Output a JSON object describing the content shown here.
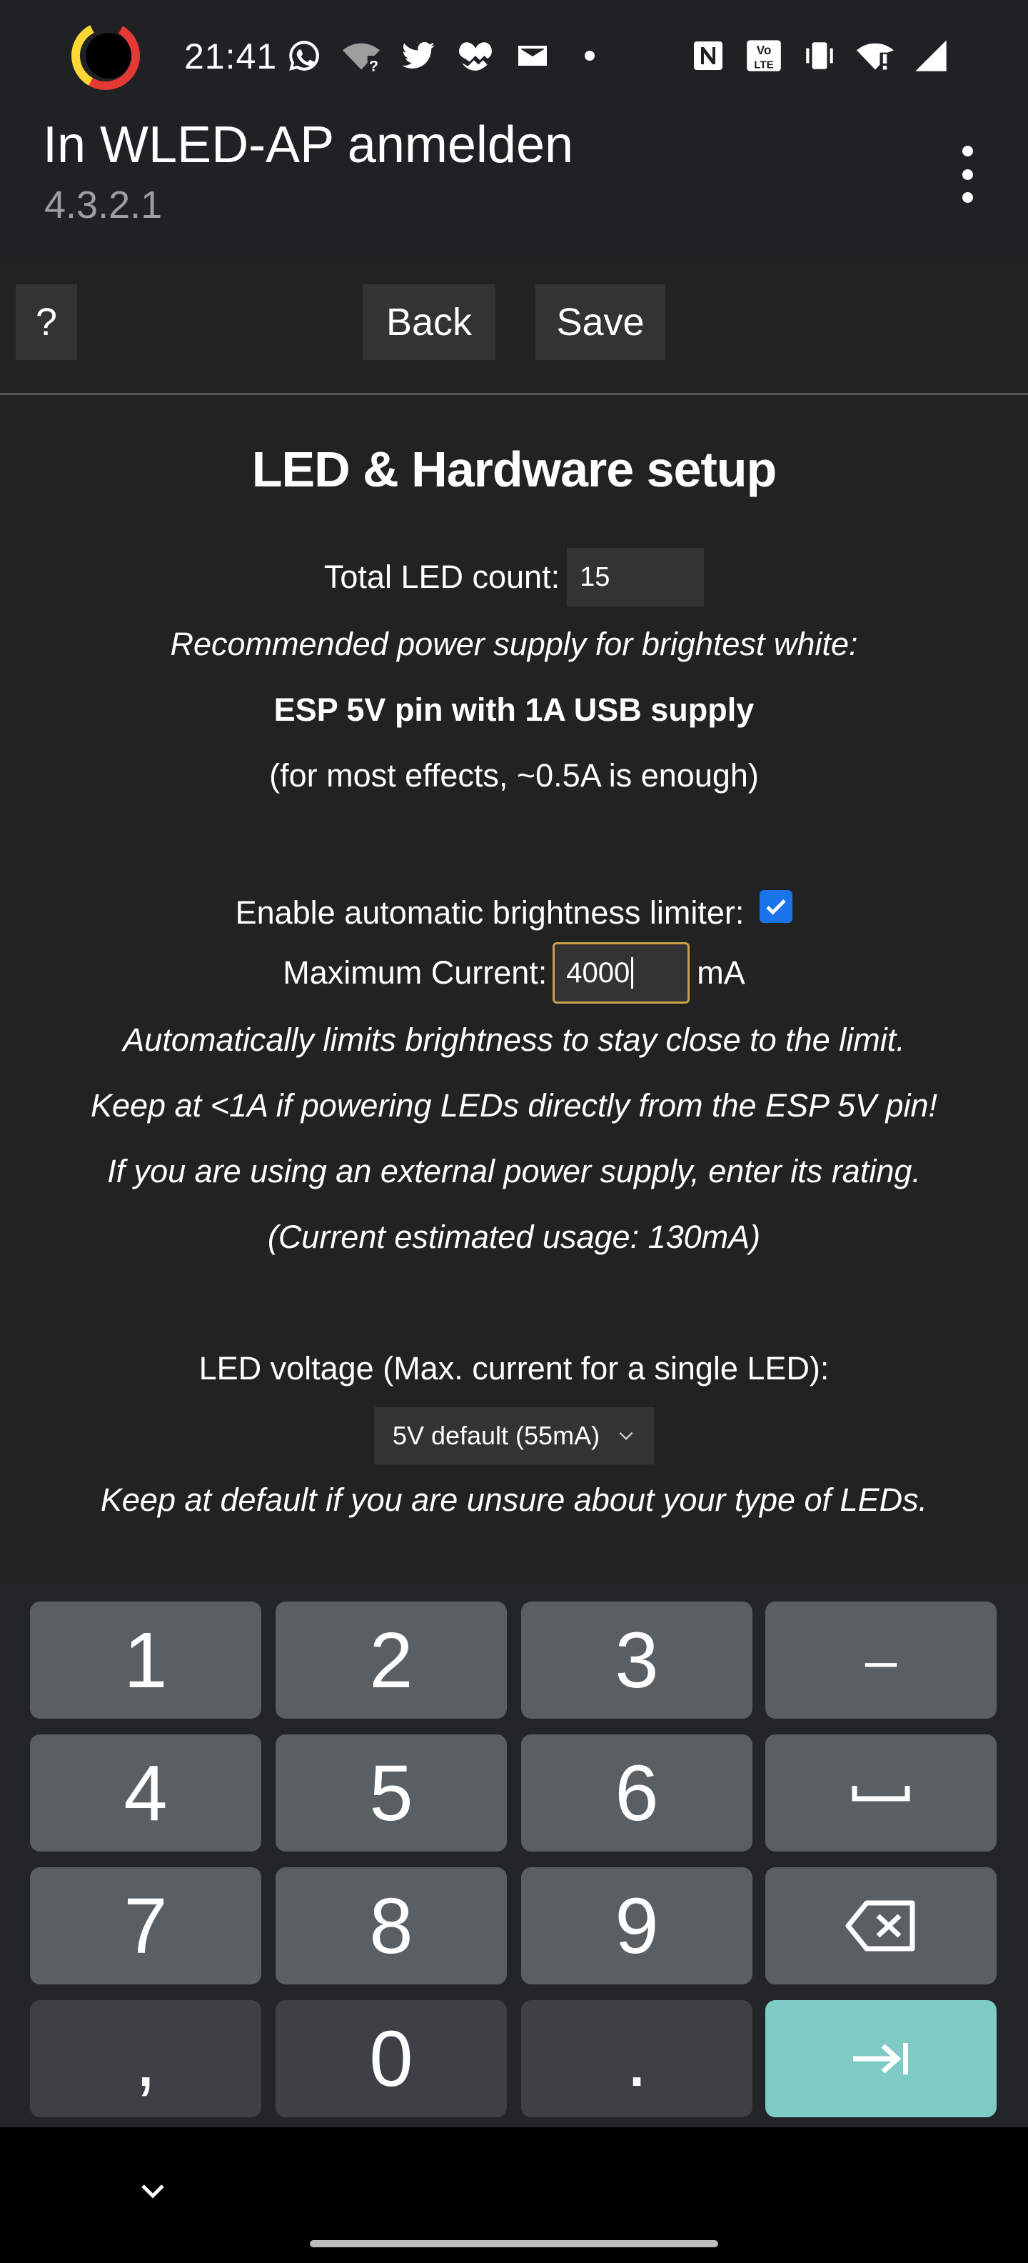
{
  "status_bar": {
    "time": "21:41",
    "notification_icons": [
      "whatsapp-icon",
      "wifi-question-icon",
      "twitter-icon",
      "gallery-icon",
      "mail-icon",
      "dot-icon"
    ],
    "system_icons": [
      "nfc-icon",
      "volte-icon",
      "vibrate-icon",
      "wifi-alert-icon",
      "signal-icon"
    ]
  },
  "app_bar": {
    "title": "In WLED-AP anmelden",
    "subtitle": "4.3.2.1"
  },
  "toolbar": {
    "help_label": "?",
    "back_label": "Back",
    "save_label": "Save"
  },
  "page": {
    "heading": "LED & Hardware setup",
    "led_count_label": "Total LED count:",
    "led_count_value": "15",
    "recommend_text": "Recommended power supply for brightest white:",
    "supply_text": "ESP 5V pin with 1A USB supply",
    "effects_text": "(for most effects, ~0.5A is enough)",
    "limiter_label": "Enable automatic brightness limiter:",
    "limiter_enabled": true,
    "max_current_label": "Maximum Current:",
    "max_current_value": "4000",
    "max_current_unit": "mA",
    "info_1": "Automatically limits brightness to stay close to the limit.",
    "info_2": "Keep at <1A if powering LEDs directly from the ESP 5V pin!",
    "info_3": "If you are using an external power supply, enter its rating.",
    "info_4": "(Current estimated usage: 130mA)",
    "voltage_label": "LED voltage (Max. current for a single LED):",
    "voltage_selected": "5V default (55mA)",
    "voltage_note": "Keep at default if you are unsure about your type of LEDs."
  },
  "keyboard": {
    "row1": [
      "1",
      "2",
      "3",
      "–"
    ],
    "row2": [
      "4",
      "5",
      "6"
    ],
    "row3": [
      "7",
      "8",
      "9"
    ],
    "row4": [
      ",",
      "0",
      "."
    ]
  }
}
